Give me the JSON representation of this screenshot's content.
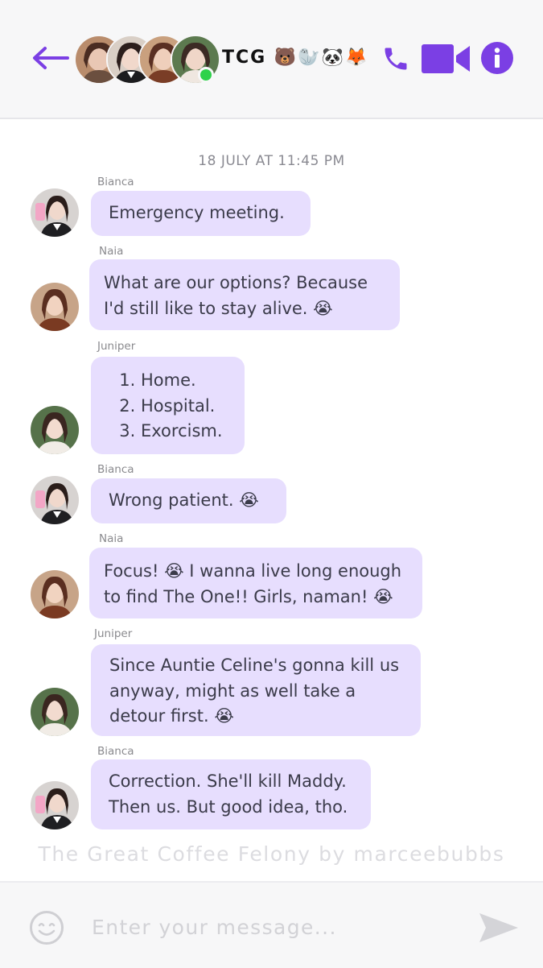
{
  "header": {
    "group_name": "TCG 🐻🦭🐼🦊",
    "online": true,
    "icons": [
      "back-arrow-icon",
      "phone-icon",
      "video-icon",
      "info-icon"
    ],
    "accent_color": "#7b3fe4"
  },
  "chat": {
    "timestamp": "18 JULY AT 11:45 PM",
    "messages": [
      {
        "sender": "Bianca",
        "lines": [
          "Emergency meeting."
        ]
      },
      {
        "sender": "Naia",
        "lines": [
          "What are our options? Because",
          "I'd still like to stay alive. 😭"
        ]
      },
      {
        "sender": "Juniper",
        "list": [
          "Home.",
          "Hospital.",
          "Exorcism."
        ]
      },
      {
        "sender": "Bianca",
        "lines": [
          "Wrong patient. 😭"
        ]
      },
      {
        "sender": "Naia",
        "lines": [
          "Focus! 😭 I wanna live long enough",
          "to find The One!! Girls, naman! 😭"
        ]
      },
      {
        "sender": "Juniper",
        "lines": [
          "Since Auntie Celine's gonna kill us",
          "anyway, might as well take a",
          "detour first. 😭"
        ]
      },
      {
        "sender": "Bianca",
        "lines": [
          "Correction. She'll kill Maddy.",
          "Then us. But good idea, tho."
        ]
      }
    ],
    "bubble_color": "#e7defe"
  },
  "watermark": "The Great Coffee Felony by marceebubbs",
  "composer": {
    "placeholder": "Enter your message...",
    "icons": [
      "smiley-icon",
      "send-icon"
    ]
  }
}
